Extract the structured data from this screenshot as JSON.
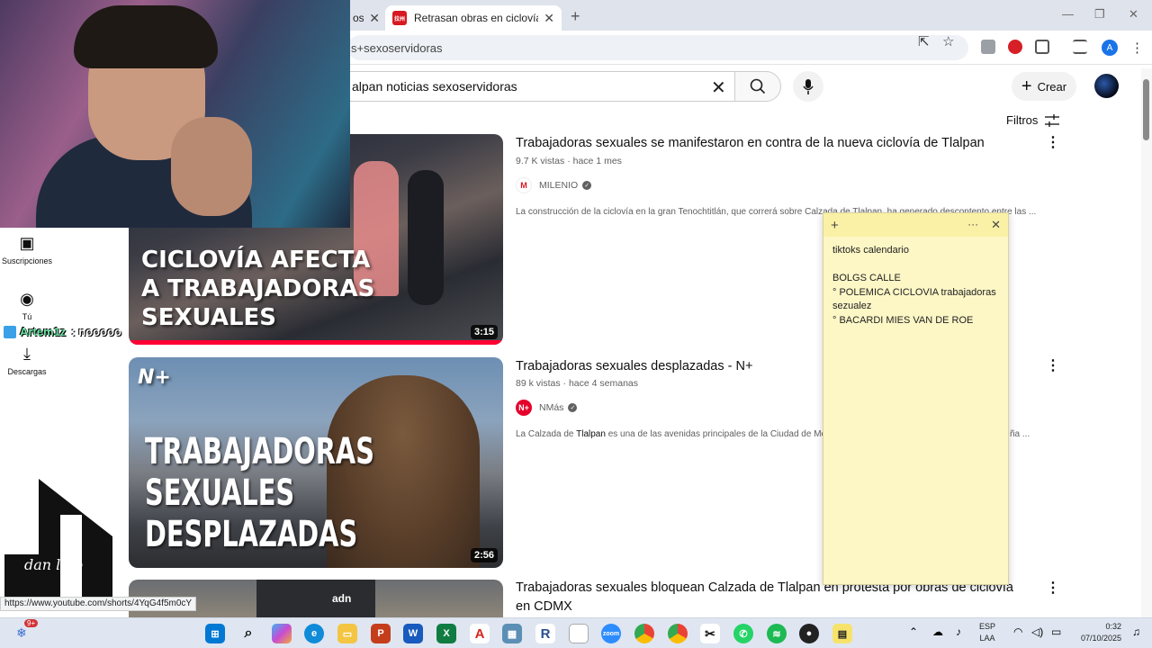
{
  "browser": {
    "tab_partial_label": "os",
    "tab_active_title": "Retrasan obras en ciclovía de Tl",
    "tab_active_favicon": "拉州",
    "address_partial": "s+sexoservidoras",
    "profile_letter": "A",
    "new_tab_symbol": "+"
  },
  "youtube": {
    "search_value": "alpan noticias sexoservidoras",
    "create_label": "Crear",
    "filters_label": "Filtros",
    "sidebar": [
      {
        "icon": "subscriptions-icon",
        "label": "Suscripciones"
      },
      {
        "icon": "you-icon",
        "label": "Tú"
      },
      {
        "icon": "downloads-icon",
        "label": "Descargas"
      }
    ],
    "results": [
      {
        "title": "Trabajadoras sexuales se manifestaron en contra de la nueva ciclovía de Tlalpan",
        "views": "9.7 K vistas",
        "age": "hace 1 mes",
        "channel": "MILENIO",
        "channel_letter": "M",
        "description": "La construcción de la ciclovía en la gran Tenochtitlán, que correrá sobre Calzada de Tlalpan, ha generado descontento entre las ...",
        "duration": "3:15",
        "overlay": [
          "CICLOVÍA AFECTA",
          "A TRABAJADORAS",
          "SEXUALES"
        ]
      },
      {
        "title": "Trabajadoras sexuales desplazadas - N+",
        "views": "89 k vistas",
        "age": "hace 4 semanas",
        "channel": "NMás",
        "channel_letter": "N+",
        "description_a": "La Calzada de",
        "description_b": "Tlalpan",
        "description_c": "es una de las avenidas principales de la Ciudad de Méx",
        "description_tail": "ña ...",
        "duration": "2:56",
        "overlay": [
          "TRABAJADORAS",
          "SEXUALES",
          "DESPLAZADAS"
        ],
        "badge": "N+"
      },
      {
        "title_line1": "Trabajadoras sexuales bloquean Calzada de Tlalpan en protesta por obras de ciclovía",
        "title_line2": "en CDMX",
        "thumb_brand": "adn"
      }
    ]
  },
  "sticky_note": {
    "lines": [
      "tiktoks calendario",
      "",
      "BOLGS CALLE",
      "° POLEMICA CICLOVIA trabajadoras sezualez",
      "° BACARDI MIES VAN DE ROE"
    ],
    "add_symbol": "+",
    "menu_symbol": "···",
    "close_symbol": "✕"
  },
  "stream": {
    "chat_user": "Artem1z",
    "chat_message": ": nooooo",
    "logo_signature": "dan lujo"
  },
  "status_url": "https://www.youtube.com/shorts/4YqG4f5m0cY",
  "taskbar": {
    "notification_count": "9+",
    "lang_top": "ESP",
    "lang_bottom": "LAA",
    "time": "0:32",
    "date": "07/10/2025"
  },
  "colors": {
    "youtube_red": "#ff0033",
    "sticky_yellow": "#fdf7c6",
    "milenio_red": "#d71921",
    "nmas_red": "#e4002b"
  }
}
